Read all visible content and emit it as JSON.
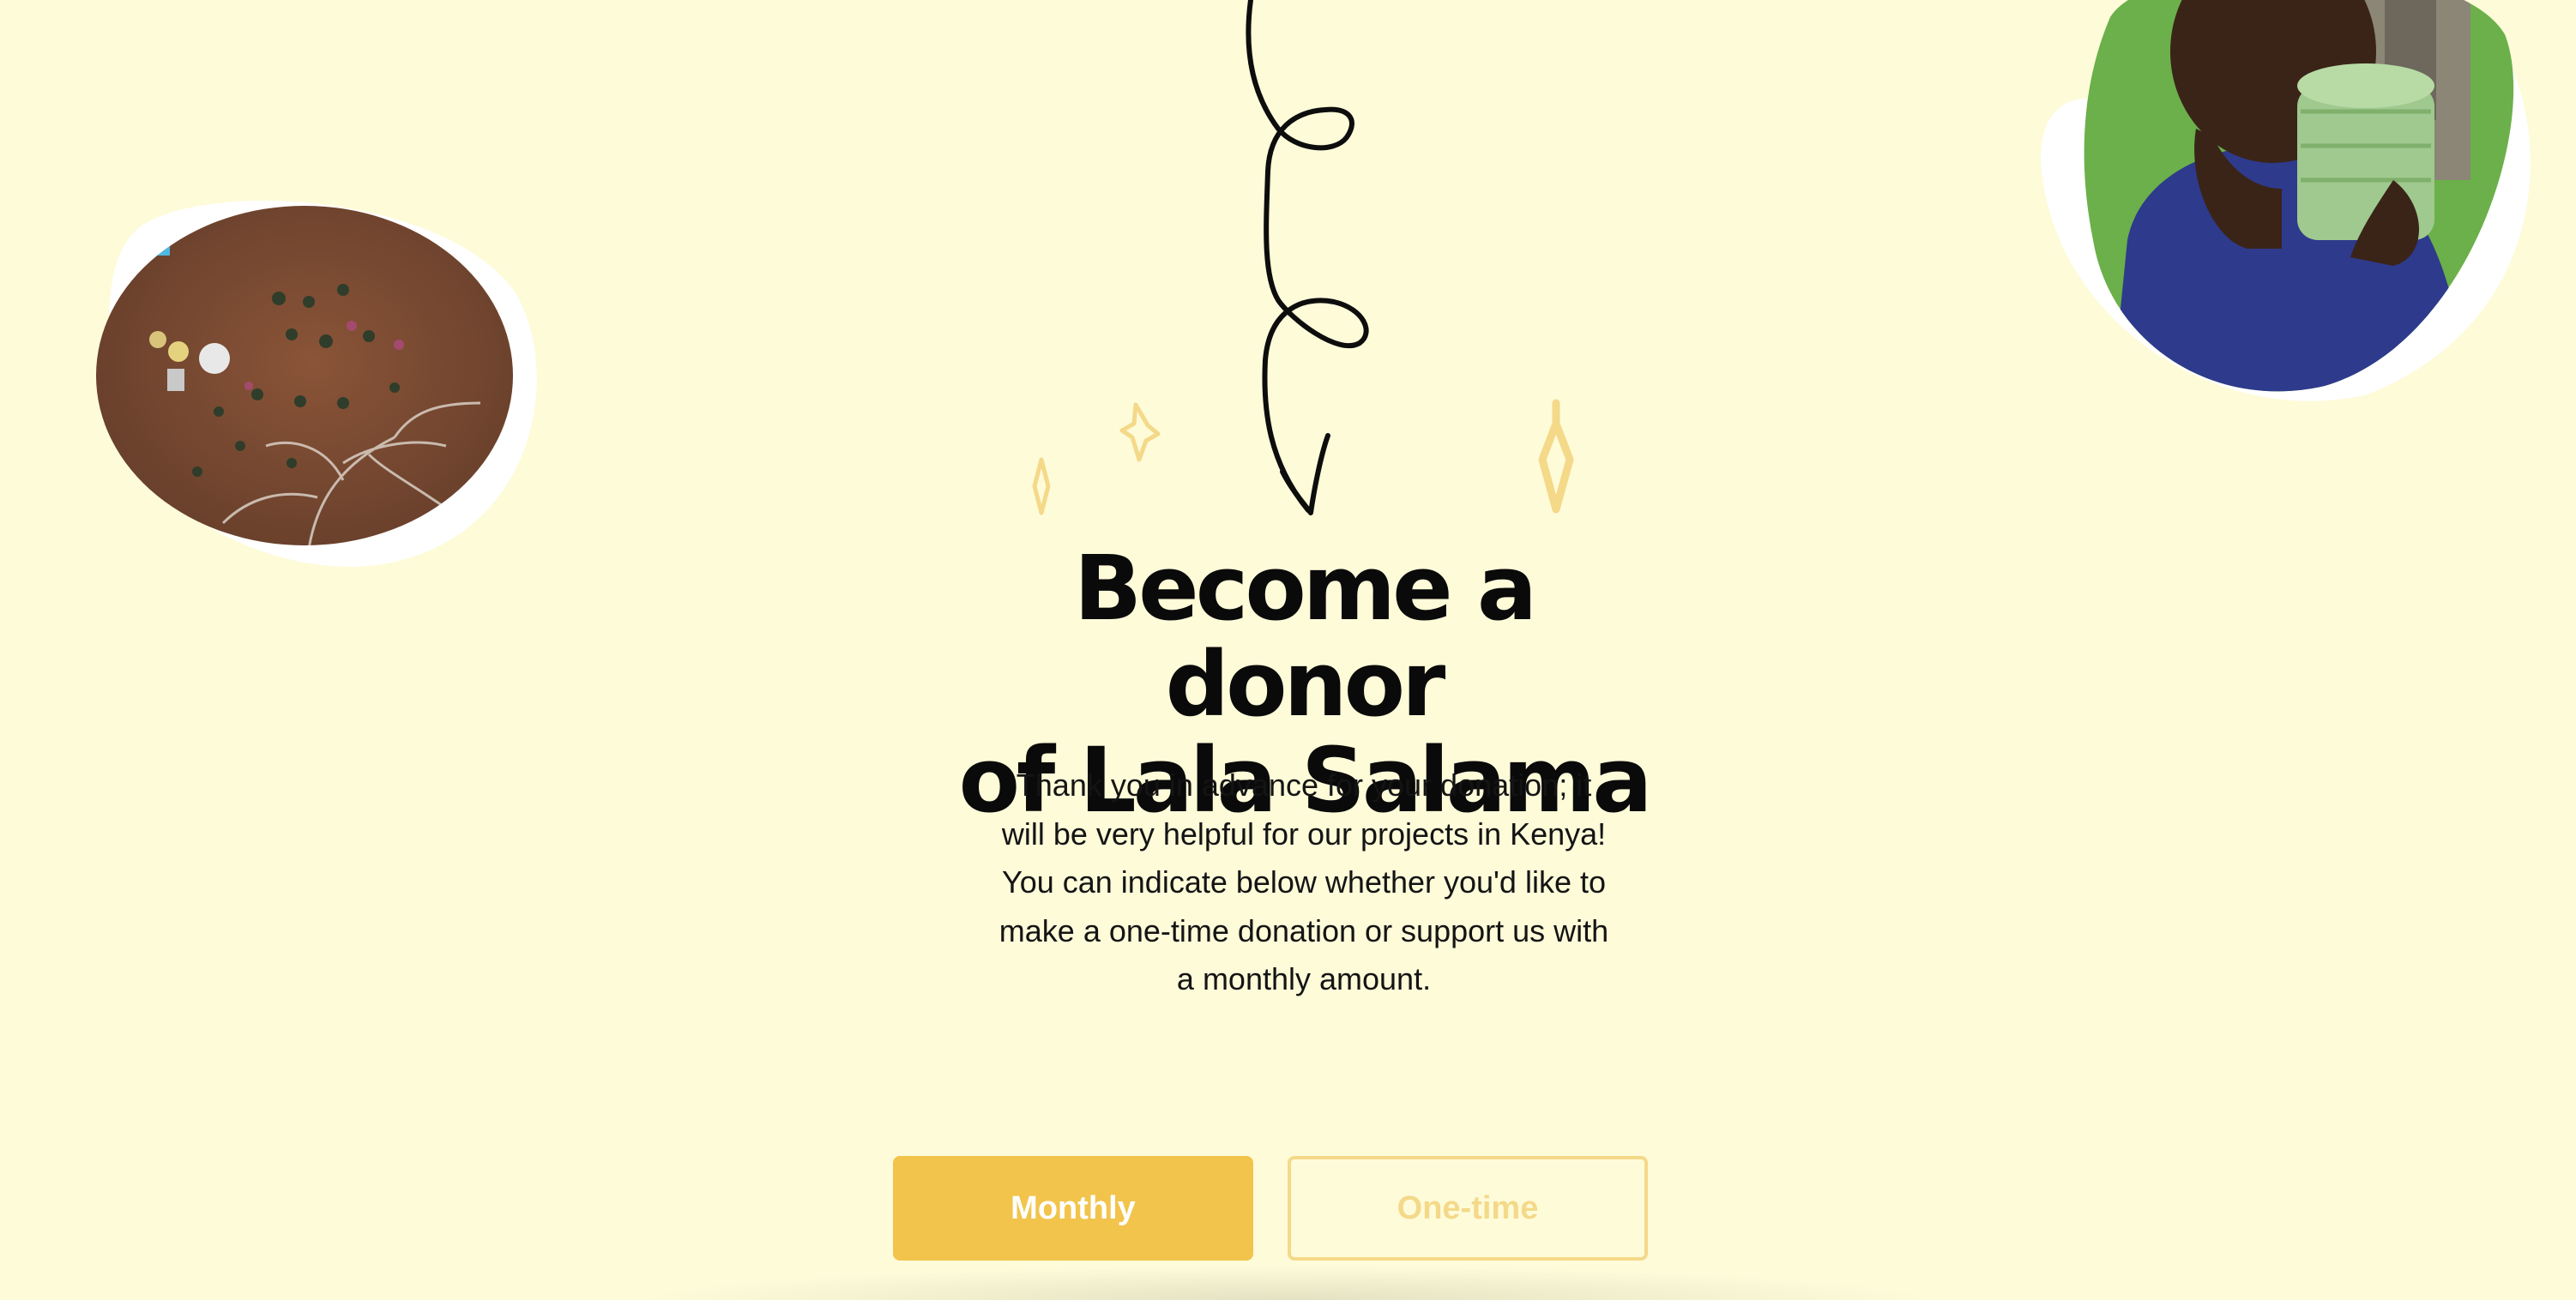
{
  "hero": {
    "title_line1": "Become a donor",
    "title_line2": "of Lala Salama",
    "description": "Thank you in advance for your donation; it will be very helpful for our projects in Kenya! You can indicate below whether you'd like to make a one-time donation or support us with a monthly amount."
  },
  "donation_toggle": {
    "monthly_label": "Monthly",
    "onetime_label": "One-time",
    "selected": "Monthly"
  },
  "icons": {
    "squiggle": "squiggle-arrow-icon",
    "sparkle": "sparkle-icon"
  },
  "colors": {
    "background": "#fefbd9",
    "accent": "#f2c44c",
    "accent_light": "#f4d989",
    "text": "#0a0a0a"
  }
}
